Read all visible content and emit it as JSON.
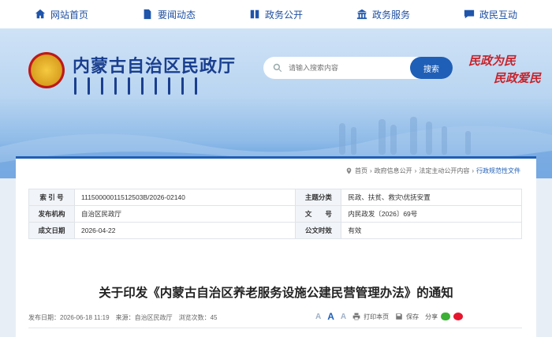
{
  "nav": {
    "items": [
      {
        "label": "网站首页",
        "icon": "home-icon"
      },
      {
        "label": "要闻动态",
        "icon": "document-icon"
      },
      {
        "label": "政务公开",
        "icon": "book-icon"
      },
      {
        "label": "政务服务",
        "icon": "building-icon"
      },
      {
        "label": "政民互动",
        "icon": "chat-icon"
      }
    ]
  },
  "header": {
    "title": "内蒙古自治区民政厅",
    "search_placeholder": "请输入搜索内容",
    "search_button": "搜索",
    "slogan_line1": "民政为民",
    "slogan_line2": "民政爱民"
  },
  "breadcrumb": [
    "首页",
    "政府信息公开",
    "法定主动公开内容",
    "行政规范性文件"
  ],
  "meta": {
    "rows": [
      {
        "k1": "索 引 号",
        "v1": "11150000011512503B/2026-02140",
        "k2": "主题分类",
        "v2": "民政、扶贫、救灾\\优抚安置"
      },
      {
        "k1": "发布机构",
        "v1": "自治区民政厅",
        "k2": "文　　号",
        "v2": "内民政发〔2026〕69号"
      },
      {
        "k1": "成文日期",
        "v1": "2026-04-22",
        "k2": "公文时效",
        "v2": "有效"
      }
    ]
  },
  "document": {
    "title": "关于印发《内蒙古自治区养老服务设施公建民营管理办法》的通知",
    "info": "发布日期：2026-06-18 11:19　来源：自治区民政厅　浏览次数：45"
  },
  "tools": {
    "font_a": "A",
    "print": "打印本页",
    "save": "保存",
    "share": "分享"
  }
}
